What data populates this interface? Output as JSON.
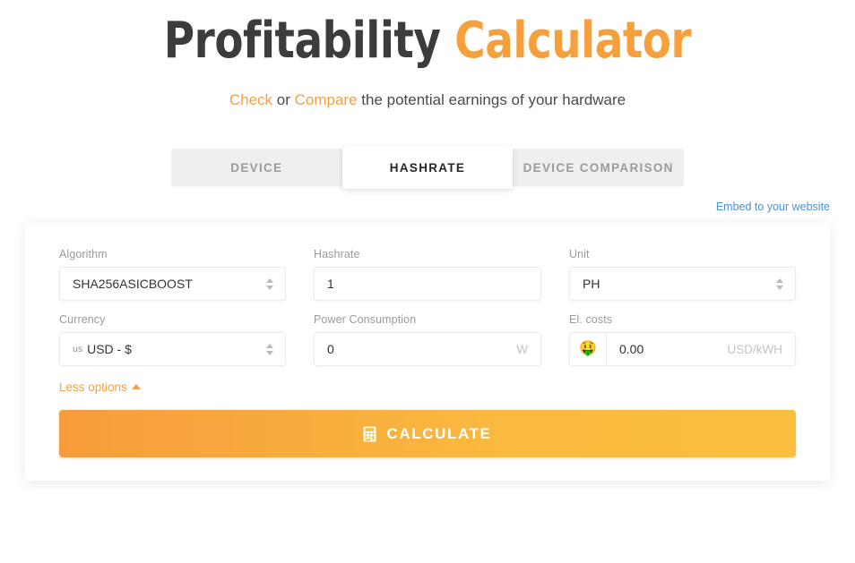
{
  "header": {
    "title_main": "Profitability",
    "title_accent": "Calculator",
    "subtitle_link1": "Check",
    "subtitle_mid": " or ",
    "subtitle_link2": "Compare",
    "subtitle_rest": " the potential earnings of your hardware"
  },
  "tabs": [
    {
      "label": "DEVICE",
      "active": false
    },
    {
      "label": "HASHRATE",
      "active": true
    },
    {
      "label": "DEVICE COMPARISON",
      "active": false
    }
  ],
  "embed": {
    "label": "Embed to your website"
  },
  "form": {
    "algorithm": {
      "label": "Algorithm",
      "value": "SHA256ASICBOOST"
    },
    "hashrate": {
      "label": "Hashrate",
      "value": "1"
    },
    "unit": {
      "label": "Unit",
      "value": "PH"
    },
    "currency": {
      "label": "Currency",
      "prefix": "us",
      "value": "USD - $"
    },
    "power": {
      "label": "Power Consumption",
      "value": "0",
      "suffix": "W"
    },
    "el_costs": {
      "label": "El. costs",
      "icon": "money-mouth-face-emoji",
      "icon_glyph": "🤑",
      "value": "0.00",
      "suffix": "USD/kWH"
    },
    "less_options": {
      "label": "Less options",
      "caret": "caret-up-icon"
    }
  },
  "actions": {
    "calculate": {
      "label": "CALCULATE",
      "icon": "calculator-icon"
    }
  },
  "colors": {
    "accent_orange": "#f5a03c",
    "link_blue": "#4d90d9",
    "button_gradient_start": "#f79c3c",
    "button_gradient_end": "#fbbf3f",
    "title_dark": "#3c3c3c"
  }
}
